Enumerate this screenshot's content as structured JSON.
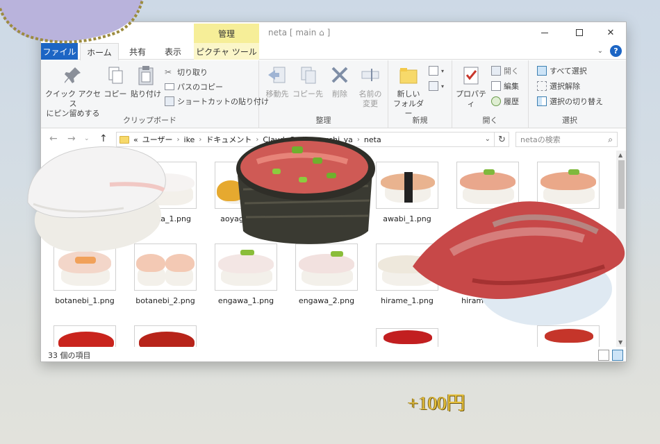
{
  "window": {
    "title": "neta [ main ⌂ ]",
    "contextual_tab_header": "管理"
  },
  "tabs": {
    "file": "ファイル",
    "home": "ホーム",
    "share": "共有",
    "view": "表示",
    "picture_tools": "ピクチャ ツール"
  },
  "ribbon": {
    "clipboard": {
      "label": "クリップボード",
      "pin_line1": "クイック アクセス",
      "pin_line2": "にピン留めする",
      "copy": "コピー",
      "paste": "貼り付け",
      "cut": "切り取り",
      "copy_path": "パスのコピー",
      "paste_shortcut": "ショートカットの貼り付け"
    },
    "organize": {
      "label": "整理",
      "move_to": "移動先",
      "copy_to": "コピー先",
      "delete": "削除",
      "rename_line1": "名前の",
      "rename_line2": "変更"
    },
    "new": {
      "label": "新規",
      "new_folder_line1": "新しい",
      "new_folder_line2": "フォルダー"
    },
    "open": {
      "label": "開く",
      "properties": "プロパティ",
      "open": "開く",
      "edit": "編集",
      "history": "履歴"
    },
    "select": {
      "label": "選択",
      "select_all": "すべて選択",
      "select_none": "選択解除",
      "invert": "選択の切り替え"
    }
  },
  "address": {
    "prefix": "«",
    "crumbs": [
      "ユーザー",
      "ike",
      "ドキュメント",
      "ClaudeCode",
      "sushi_ya",
      "neta"
    ],
    "search_placeholder": "netaの検索"
  },
  "files": [
    {
      "name": "aoriika_1.png"
    },
    {
      "name": "aoyagi_1.png"
    },
    {
      "name": "awabi_1.png"
    },
    {
      "name": "botanebi_1.png"
    },
    {
      "name": "botanebi_2.png"
    },
    {
      "name": "engawa_1.png"
    },
    {
      "name": "engawa_2.png"
    },
    {
      "name": "hirame_1.png"
    },
    {
      "name": "hirame_2.png"
    }
  ],
  "status": {
    "item_count": "33 個の項目"
  },
  "overlay": {
    "price_text": "+100円"
  },
  "colors": {
    "accent": "#1c65c4",
    "context_tab": "#f6ee98",
    "price": "#e9c23c"
  }
}
